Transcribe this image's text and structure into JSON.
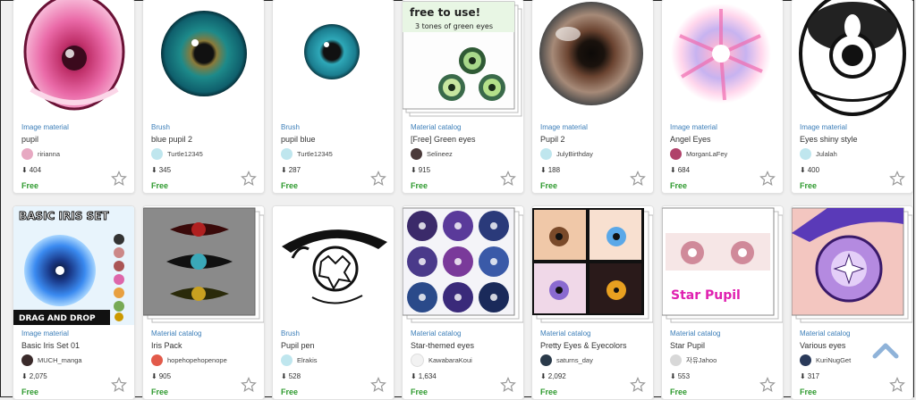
{
  "items": [
    {
      "category": "Image material",
      "title": "pupil",
      "author": "ririanna",
      "downloads": "404",
      "price": "Free"
    },
    {
      "category": "Brush",
      "title": "blue pupil 2",
      "author": "Turtle12345",
      "downloads": "345",
      "price": "Free"
    },
    {
      "category": "Brush",
      "title": "pupil blue",
      "author": "Turtle12345",
      "downloads": "287",
      "price": "Free"
    },
    {
      "category": "Material catalog",
      "title": "[Free] Green eyes",
      "author": "Selineez",
      "downloads": "915",
      "price": "Free"
    },
    {
      "category": "Image material",
      "title": "Pupil 2",
      "author": "JulyBirthday",
      "downloads": "188",
      "price": "Free"
    },
    {
      "category": "Image material",
      "title": "Angel Eyes",
      "author": "MorganLaFey",
      "downloads": "684",
      "price": "Free"
    },
    {
      "category": "Image material",
      "title": "Eyes shiny style",
      "author": "Julalah",
      "downloads": "400",
      "price": "Free"
    },
    {
      "category": "Image material",
      "title": "Basic Iris Set 01",
      "author": "MUCH_manga",
      "downloads": "2,075",
      "price": "Free"
    },
    {
      "category": "Material catalog",
      "title": "Iris Pack",
      "author": "hopehopehopenope",
      "downloads": "905",
      "price": "Free"
    },
    {
      "category": "Brush",
      "title": "Pupil pen",
      "author": "Elrakis",
      "downloads": "528",
      "price": "Free"
    },
    {
      "category": "Material catalog",
      "title": "Star-themed eyes",
      "author": "KawabaraKoui",
      "downloads": "1,634",
      "price": "Free"
    },
    {
      "category": "Material catalog",
      "title": "Pretty Eyes & Eyecolors",
      "author": "saturns_day",
      "downloads": "2,092",
      "price": "Free"
    },
    {
      "category": "Material catalog",
      "title": "Star Pupil",
      "author": "자유Jahoo",
      "downloads": "553",
      "price": "Free"
    },
    {
      "category": "Material catalog",
      "title": "Various eyes",
      "author": "KuriNugGet",
      "downloads": "317",
      "price": "Free"
    }
  ],
  "thumb_text": {
    "green_eyes_line1": "free to use!",
    "green_eyes_line2": "3 tones of green eyes",
    "iris_set_title": "BASIC IRIS SET",
    "iris_set_footer": "DRAG AND DROP",
    "star_pupil_label": "Star Pupil"
  },
  "icons": {
    "download": "download-icon",
    "favorite": "star-outline-icon",
    "scroll_top": "chevron-up-icon"
  },
  "colors": {
    "category": "#3d7fb9",
    "price": "#2e9a2e",
    "scroll_top": "#8fb3d9"
  }
}
